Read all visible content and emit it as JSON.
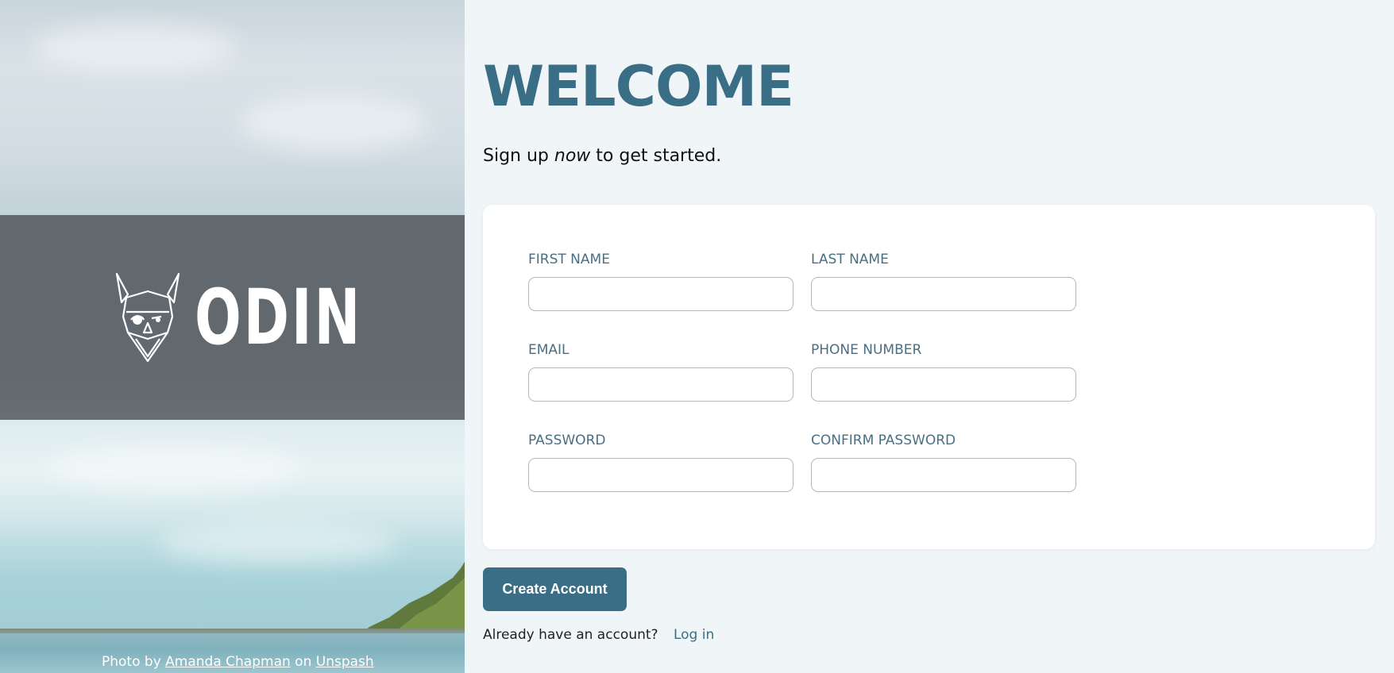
{
  "hero": {
    "logo_text": "ODIN",
    "logo_icon": "viking-head-icon",
    "credit": {
      "prefix": "Photo by",
      "author": "Amanda Chapman",
      "middle": "on",
      "site": "Unspash"
    }
  },
  "main": {
    "title": "WELCOME",
    "subtitle_before": "Sign up ",
    "subtitle_emphasis": "now",
    "subtitle_after": " to get started."
  },
  "form": {
    "fields": [
      {
        "label": "FIRST NAME",
        "value": "",
        "placeholder": ""
      },
      {
        "label": "LAST NAME",
        "value": "",
        "placeholder": ""
      },
      {
        "label": "EMAIL",
        "value": "",
        "placeholder": ""
      },
      {
        "label": "PHONE NUMBER",
        "value": "",
        "placeholder": ""
      },
      {
        "label": "PASSWORD",
        "value": "",
        "placeholder": ""
      },
      {
        "label": "CONFIRM PASSWORD",
        "value": "",
        "placeholder": ""
      }
    ],
    "submit_label": "Create Account"
  },
  "footer": {
    "question": "Already have an account?",
    "login_label": "Log in"
  },
  "colors": {
    "accent": "#3a6e86",
    "panel_bg": "#f0f6f7",
    "label": "#4a6f82"
  }
}
